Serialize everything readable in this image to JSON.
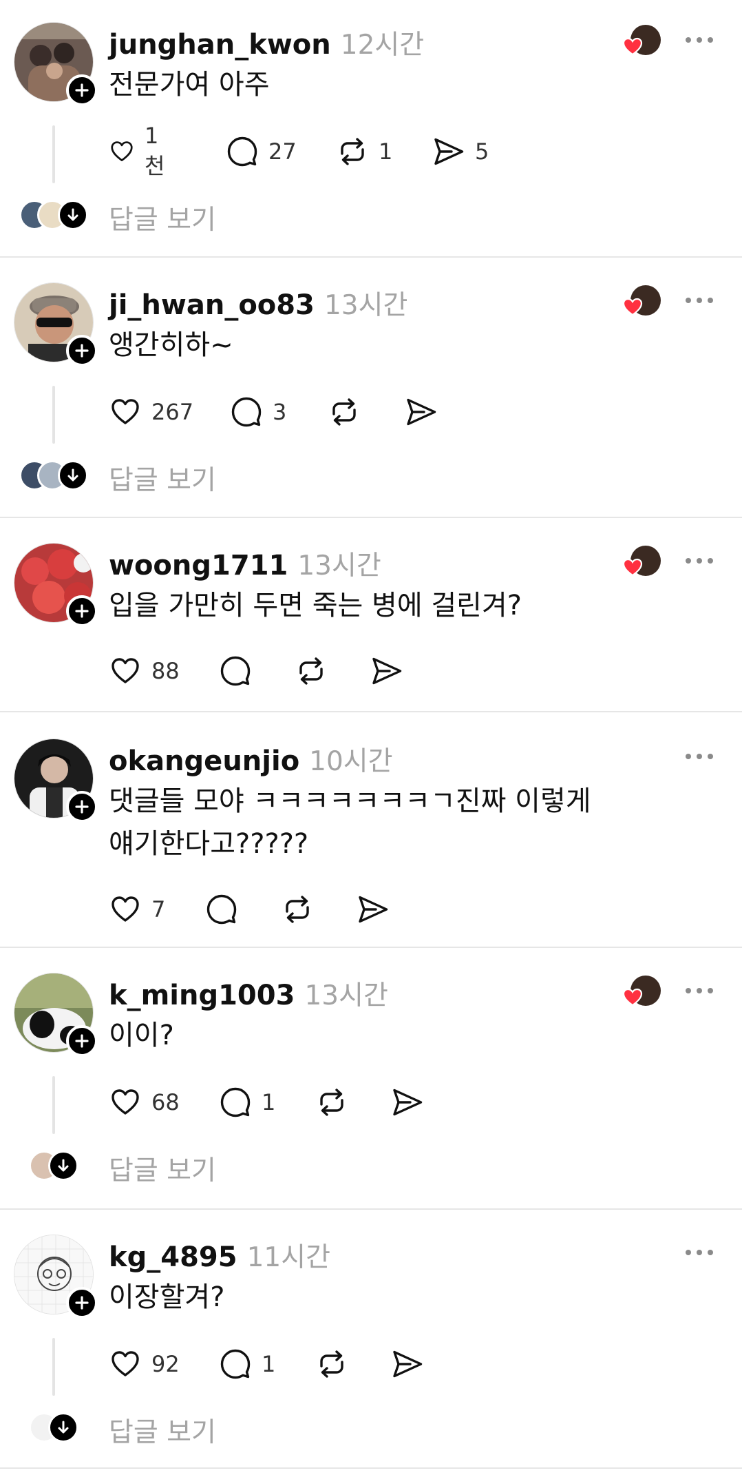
{
  "posts": [
    {
      "username": "junghan_kwon",
      "time": "12시간",
      "content": "전문가여 아주",
      "likes": "1천",
      "comments": "27",
      "reposts": "1",
      "shares": "5",
      "view_replies": "답글 보기"
    },
    {
      "username": "ji_hwan_oo83",
      "time": "13시간",
      "content": "앵간히하~",
      "likes": "267",
      "comments": "3",
      "view_replies": "답글 보기"
    },
    {
      "username": "woong1711",
      "time": "13시간",
      "content": "입을 가만히 두면 죽는 병에 걸린겨?",
      "likes": "88"
    },
    {
      "username": "okangeunjio",
      "time": "10시간",
      "content_line1": "댓글들 모야 ㅋㅋㅋㅋㅋㅋㅋㄱ진짜 이렇게",
      "content_line2": "얘기한다고?????",
      "likes": "7"
    },
    {
      "username": "k_ming1003",
      "time": "13시간",
      "content": "이이?",
      "likes": "68",
      "comments": "1",
      "view_replies": "답글 보기"
    },
    {
      "username": "kg_4895",
      "time": "11시간",
      "content": "이장할겨?",
      "likes": "92",
      "comments": "1",
      "view_replies": "답글 보기"
    }
  ],
  "icons": {
    "like": "heart-outline-icon",
    "comment": "speech-bubble-icon",
    "repost": "repost-arrows-icon",
    "share": "paper-plane-icon",
    "follow": "plus-icon",
    "more": "ellipsis-icon",
    "expand": "arrow-down-icon",
    "author_liked": "heart-filled-icon"
  },
  "colors": {
    "liked_heart": "#ff3040",
    "muted_text": "#a4a4a4",
    "divider": "#e6e6e6"
  }
}
